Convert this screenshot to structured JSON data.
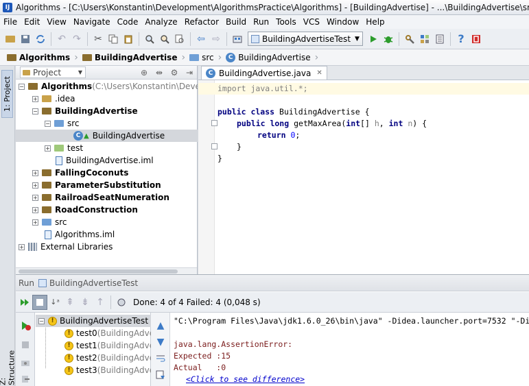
{
  "window": {
    "title": "Algorithms - [C:\\Users\\Konstantin\\Development\\AlgorithmsPractice\\Algorithms] - [BuildingAdvertise] - ...\\BuildingAdvertise\\src\\BuildingAdvertise.java"
  },
  "menu": [
    "File",
    "Edit",
    "View",
    "Navigate",
    "Code",
    "Analyze",
    "Refactor",
    "Build",
    "Run",
    "Tools",
    "VCS",
    "Window",
    "Help"
  ],
  "toolbar": {
    "run_config": "BuildingAdvertiseTest"
  },
  "breadcrumbs": [
    "Algorithms",
    "BuildingAdvertise",
    "src",
    "BuildingAdvertise"
  ],
  "side_tabs": {
    "project": "1: Project",
    "structure": "Z: Structure"
  },
  "project_panel": {
    "view_label": "Project",
    "tree": [
      {
        "label": "Algorithms",
        "suffix": " (C:\\Users\\Konstantin\\Development\\AlgorithmsPractice\\Algorithms)",
        "expander": "−"
      },
      {
        "label": ".idea",
        "expander": "+"
      },
      {
        "label": "BuildingAdvertise",
        "expander": "−"
      },
      {
        "label": "src",
        "expander": "−"
      },
      {
        "label": "BuildingAdvertise"
      },
      {
        "label": "test",
        "expander": "+"
      },
      {
        "label": "BuildingAdvertise.iml"
      },
      {
        "label": "FallingCoconuts",
        "expander": "+"
      },
      {
        "label": "ParameterSubstitution",
        "expander": "+"
      },
      {
        "label": "RailroadSeatNumeration",
        "expander": "+"
      },
      {
        "label": "RoadConstruction",
        "expander": "+"
      },
      {
        "label": "src",
        "expander": "+"
      },
      {
        "label": "Algorithms.iml"
      },
      {
        "label": "External Libraries",
        "expander": "+"
      }
    ]
  },
  "editor": {
    "tab_label": "BuildingAdvertise.java",
    "code": {
      "l1_kw": "import",
      "l1_rest": " java.util.*;",
      "l3_kw": "public class",
      "l3_rest": " BuildingAdvertise {",
      "l4_kw1": "public long",
      "l4_mid": " getMaxArea(",
      "l4_kw2": "int",
      "l4_arr": "[] ",
      "l4_p1": "h",
      "l4_comma": ", ",
      "l4_kw3": "int",
      "l4_sp": " ",
      "l4_p2": "n",
      "l4_end": ") {",
      "l5_kw": "return",
      "l5_sp": " ",
      "l5_num": "0",
      "l5_end": ";",
      "l6": "}",
      "l7": "}"
    }
  },
  "run_panel": {
    "title": "Run",
    "config": "BuildingAdvertiseTest",
    "status": "Done: 4 of 4   Failed: 4 (0,048 s)",
    "results": [
      {
        "name": "BuildingAdvertiseTest",
        "detail": ""
      },
      {
        "name": "test0",
        "detail": " (BuildingAdvertiseTest)"
      },
      {
        "name": "test1",
        "detail": " (BuildingAdvertiseTest)"
      },
      {
        "name": "test2",
        "detail": " (BuildingAdvertiseTest)"
      },
      {
        "name": "test3",
        "detail": " (BuildingAdvertiseTest)"
      }
    ],
    "console": {
      "cmd": "\"C:\\Program Files\\Java\\jdk1.6.0_26\\bin\\java\" -Didea.launcher.port=7532 \"-Didea.launcher",
      "error": "java.lang.AssertionError:",
      "expected": "Expected :15",
      "actual": "Actual   :0",
      "link": "<Click to see difference>"
    }
  },
  "icons": {
    "warning": "warning-icon",
    "run": "run-icon",
    "debug": "debug-icon",
    "help": "help-icon"
  },
  "colors": {
    "keyword": "#000080",
    "number": "#0000ff",
    "error_text": "#7a1b1b",
    "link": "#0000cc",
    "run_green": "#2c9c2c",
    "stop_red": "#d12a2a",
    "current_line": "#fffae3"
  }
}
